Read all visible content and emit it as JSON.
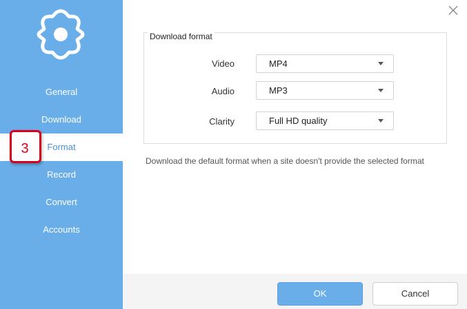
{
  "sidebar": {
    "items": [
      {
        "label": "General"
      },
      {
        "label": "Download"
      },
      {
        "label": "Format"
      },
      {
        "label": "Record"
      },
      {
        "label": "Convert"
      },
      {
        "label": "Accounts"
      }
    ],
    "active_index": 2,
    "step_badge": "3",
    "logo_icon": "gear-icon"
  },
  "format_group": {
    "title": "Download format",
    "rows": [
      {
        "label": "Video",
        "value": "MP4"
      },
      {
        "label": "Audio",
        "value": "MP3"
      },
      {
        "label": "Clarity",
        "value": "Full HD quality"
      }
    ]
  },
  "note": "Download the default format when a site doesn't provide the selected format",
  "footer": {
    "ok_label": "OK",
    "cancel_label": "Cancel"
  },
  "colors": {
    "sidebar_bg": "#6aaee9",
    "accent": "#4a90d9",
    "badge_border": "#d9001b"
  }
}
